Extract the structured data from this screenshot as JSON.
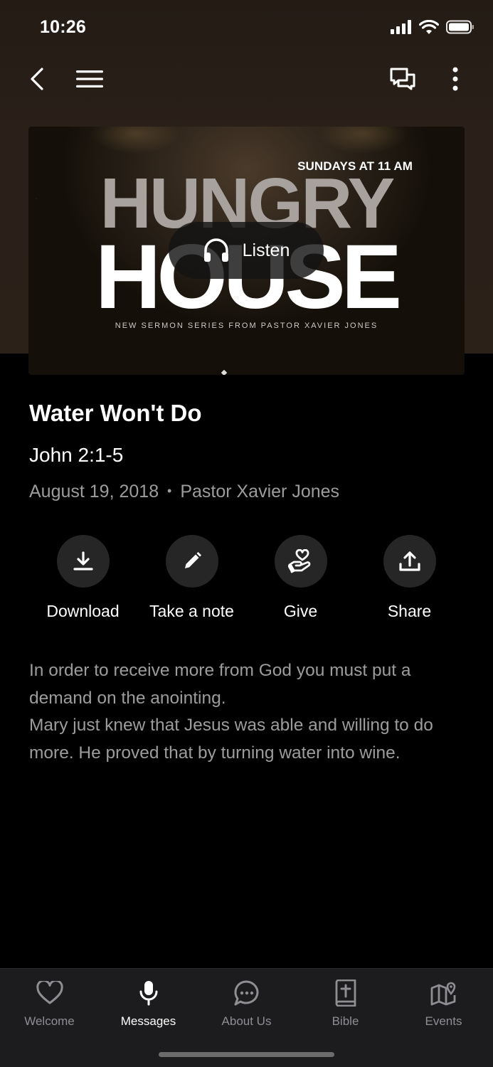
{
  "status_bar": {
    "time": "10:26"
  },
  "artwork": {
    "sundays": "SUNDAYS AT 11 AM",
    "title_line1": "HUNGRY",
    "title_line2": "HOUSE",
    "subtitle": "NEW SERMON SERIES FROM PASTOR XAVIER JONES",
    "listen_label": "Listen"
  },
  "sermon": {
    "title": "Water Won't Do",
    "scripture": "John 2:1-5",
    "date": "August 19, 2018",
    "separator": "•",
    "speaker": "Pastor Xavier Jones",
    "description_lines": [
      "In order to receive more from God you must put a demand on the anointing.",
      "Mary just knew that Jesus was able and willing to do more. He proved that by turning water into wine."
    ]
  },
  "actions": [
    {
      "label": "Download",
      "icon": "download-icon"
    },
    {
      "label": "Take a note",
      "icon": "pencil-icon"
    },
    {
      "label": "Give",
      "icon": "give-hand-heart-icon"
    },
    {
      "label": "Share",
      "icon": "share-upload-icon"
    }
  ],
  "tabs": [
    {
      "label": "Welcome",
      "icon": "heart-icon",
      "active": false
    },
    {
      "label": "Messages",
      "icon": "microphone-icon",
      "active": true
    },
    {
      "label": "About Us",
      "icon": "chat-bubble-icon",
      "active": false
    },
    {
      "label": "Bible",
      "icon": "bible-icon",
      "active": false
    },
    {
      "label": "Events",
      "icon": "map-pin-icon",
      "active": false
    }
  ],
  "colors": {
    "background": "#000000",
    "header": "#2a2019",
    "tab_bar": "#1c1c1e",
    "muted_text": "#9c9c9c",
    "action_circle": "#262626"
  }
}
